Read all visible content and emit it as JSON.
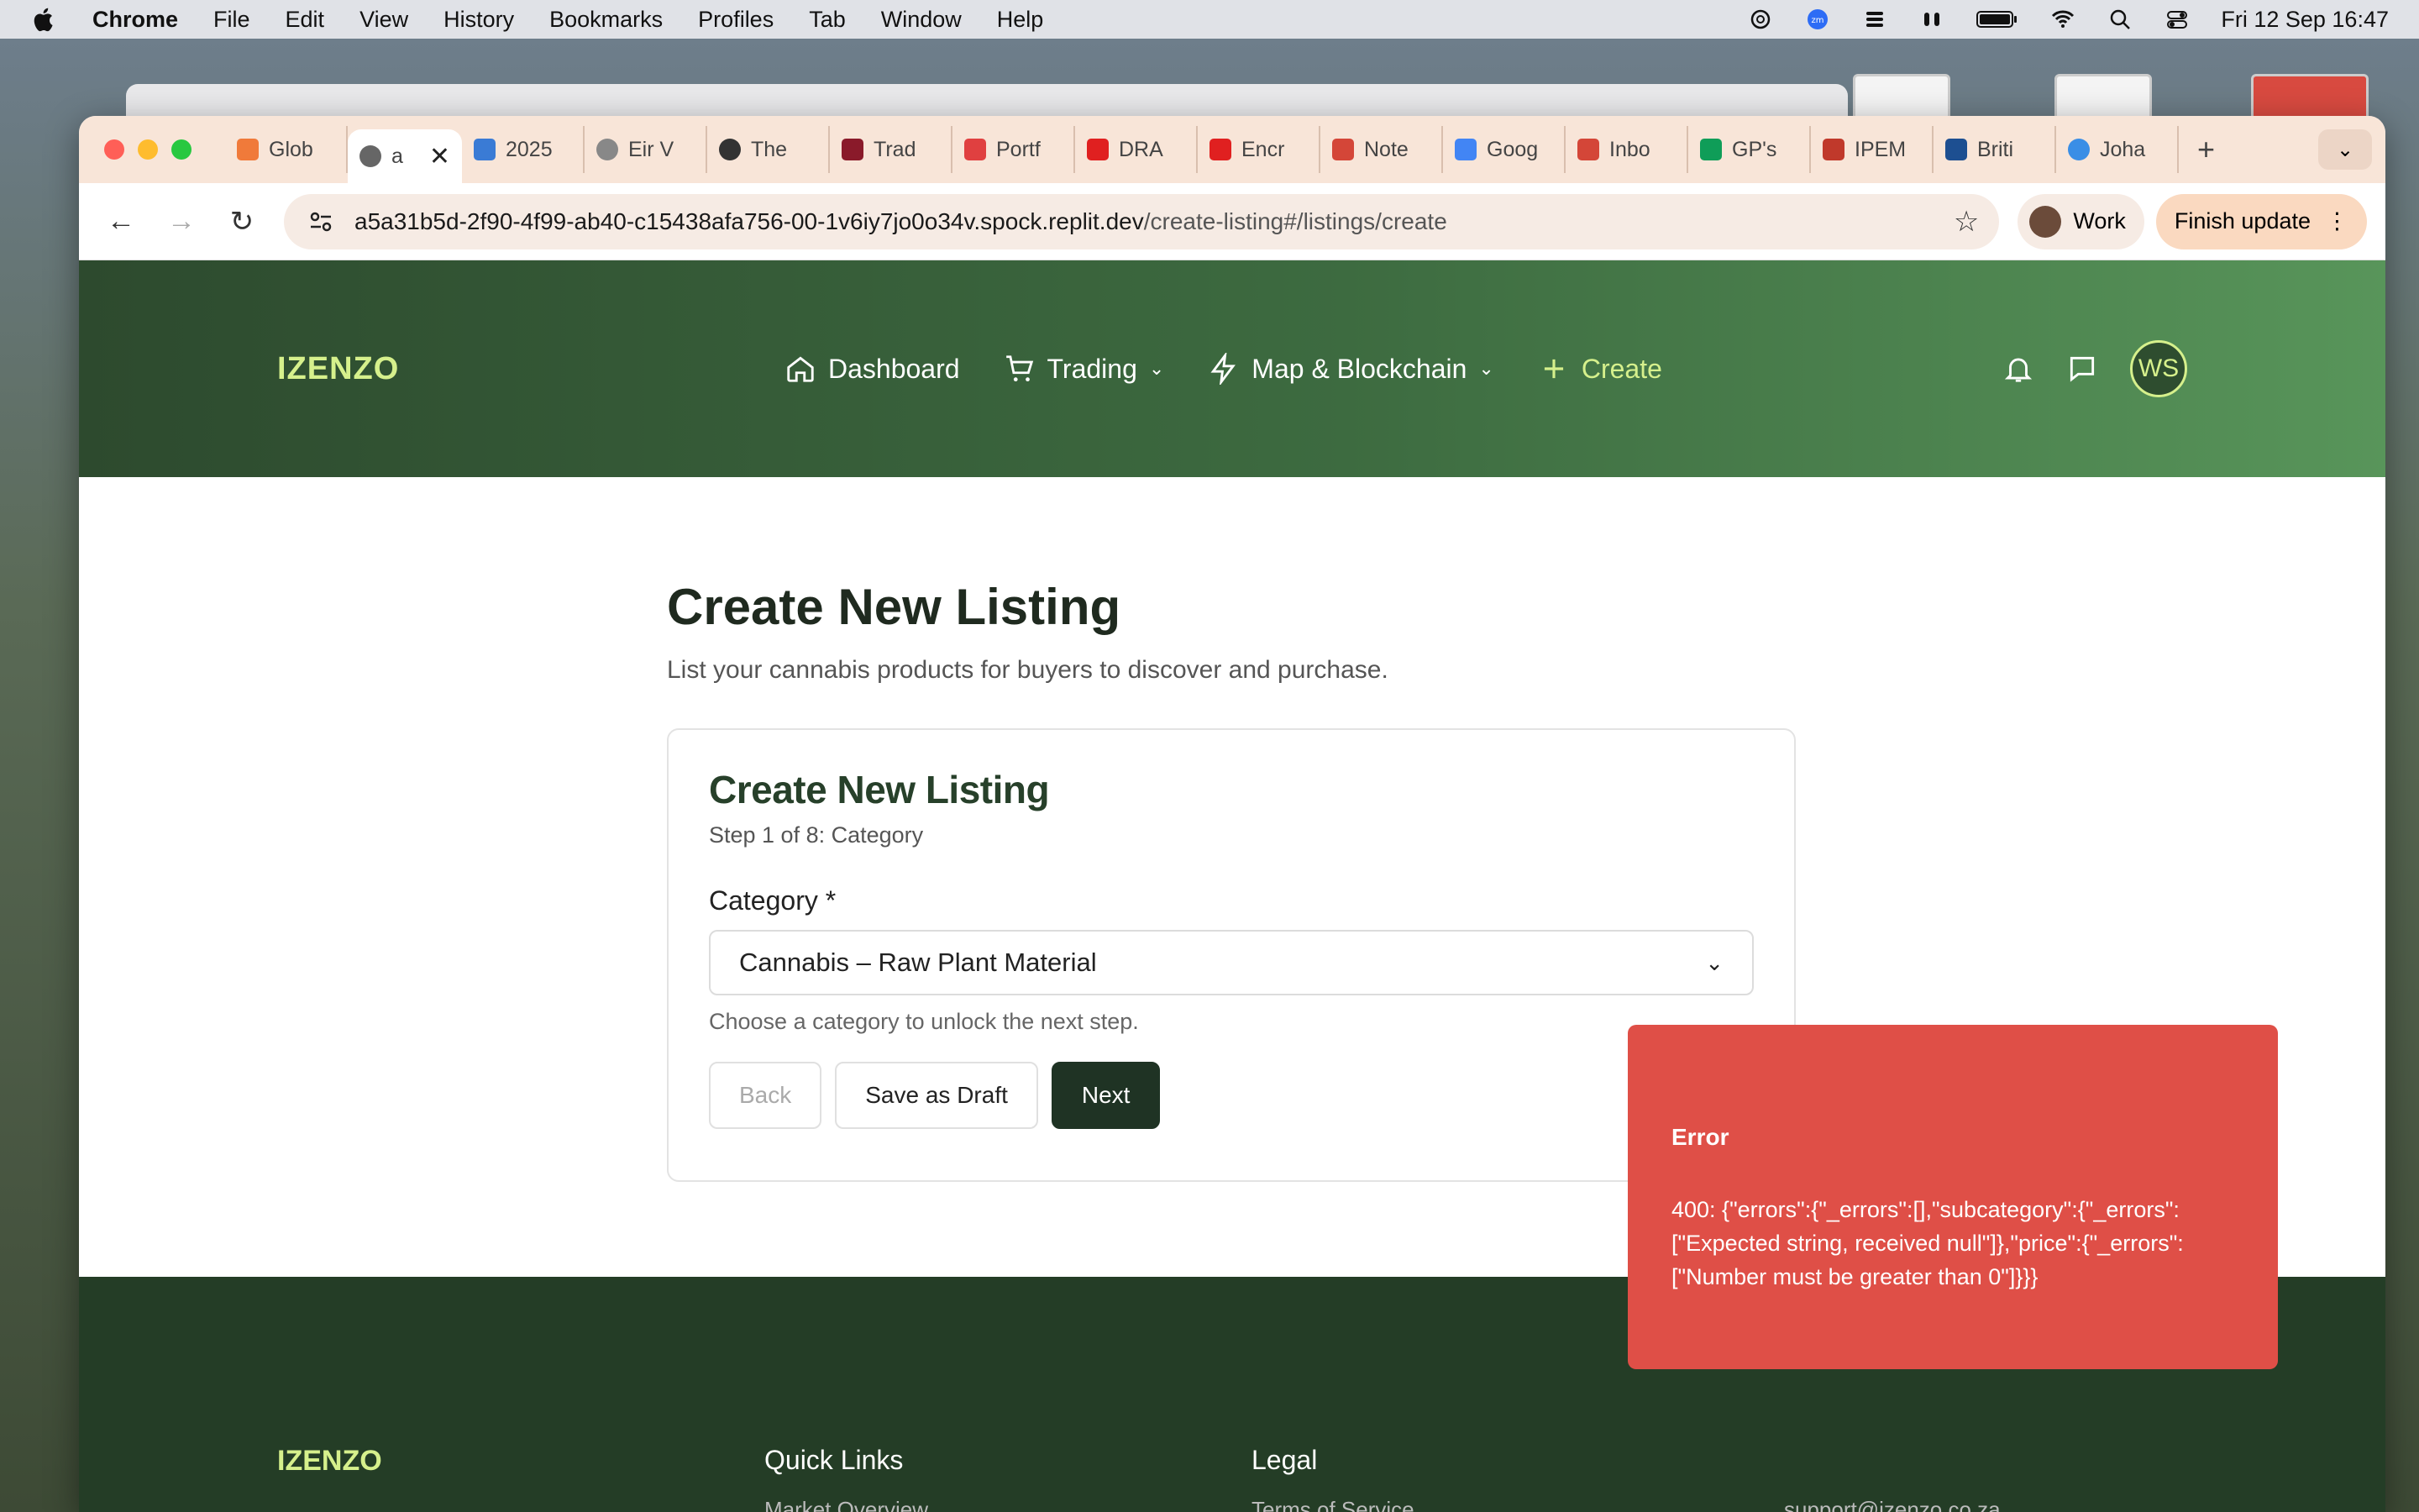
{
  "menubar": {
    "app": "Chrome",
    "items": [
      "File",
      "Edit",
      "View",
      "History",
      "Bookmarks",
      "Profiles",
      "Tab",
      "Window",
      "Help"
    ],
    "clock": "Fri 12 Sep  16:47"
  },
  "browser": {
    "tabs": [
      {
        "label": "Glob",
        "color": "#f07a3a"
      },
      {
        "label": "a",
        "color": "#666666",
        "active": true
      },
      {
        "label": "2025",
        "color": "#3a7bd5"
      },
      {
        "label": "Eir V",
        "color": "#888888"
      },
      {
        "label": "The",
        "color": "#333333"
      },
      {
        "label": "Trad",
        "color": "#8a1a2a"
      },
      {
        "label": "Portf",
        "color": "#e04040"
      },
      {
        "label": "DRA",
        "color": "#e02020"
      },
      {
        "label": "Encr",
        "color": "#e02020"
      },
      {
        "label": "Note",
        "color": "#d44638"
      },
      {
        "label": "Goog",
        "color": "#4285f4"
      },
      {
        "label": "Inbo",
        "color": "#d44638"
      },
      {
        "label": "GP's",
        "color": "#0f9d58"
      },
      {
        "label": "IPEM",
        "color": "#c0392b"
      },
      {
        "label": "Briti",
        "color": "#1d4f91"
      },
      {
        "label": "Joha",
        "color": "#3a8ee6"
      }
    ],
    "url_host": "a5a31b5d-2f90-4f99-ab40-c15438afa756-00-1v6iy7jo0o34v.spock.replit.dev",
    "url_path": "/create-listing#/listings/create",
    "profile": "Work",
    "update": "Finish update"
  },
  "site": {
    "logo": "IZENZO",
    "nav": {
      "dashboard": "Dashboard",
      "trading": "Trading",
      "map": "Map & Blockchain",
      "create": "Create"
    },
    "avatar_initials": "WS"
  },
  "page": {
    "title": "Create New Listing",
    "subtitle": "List your cannabis products for buyers to discover and purchase."
  },
  "form": {
    "title": "Create New Listing",
    "step": "Step 1 of 8: Category",
    "category_label": "Category *",
    "category_value": "Cannabis – Raw Plant Material",
    "hint": "Choose a category to unlock the next step.",
    "back": "Back",
    "draft": "Save as Draft",
    "next": "Next"
  },
  "footer": {
    "logo": "IZENZO",
    "quick_links": "Quick Links",
    "legal": "Legal",
    "quick_first": "Market Overview",
    "legal_first": "Terms of Service",
    "contact_first": "support@izenzo.co.za"
  },
  "toast": {
    "title": "Error",
    "message": "400: {\"errors\":{\"_errors\":[],\"subcategory\":{\"_errors\":[\"Expected string, received null\"]},\"price\":{\"_errors\":[\"Number must be greater than 0\"]}}}"
  }
}
